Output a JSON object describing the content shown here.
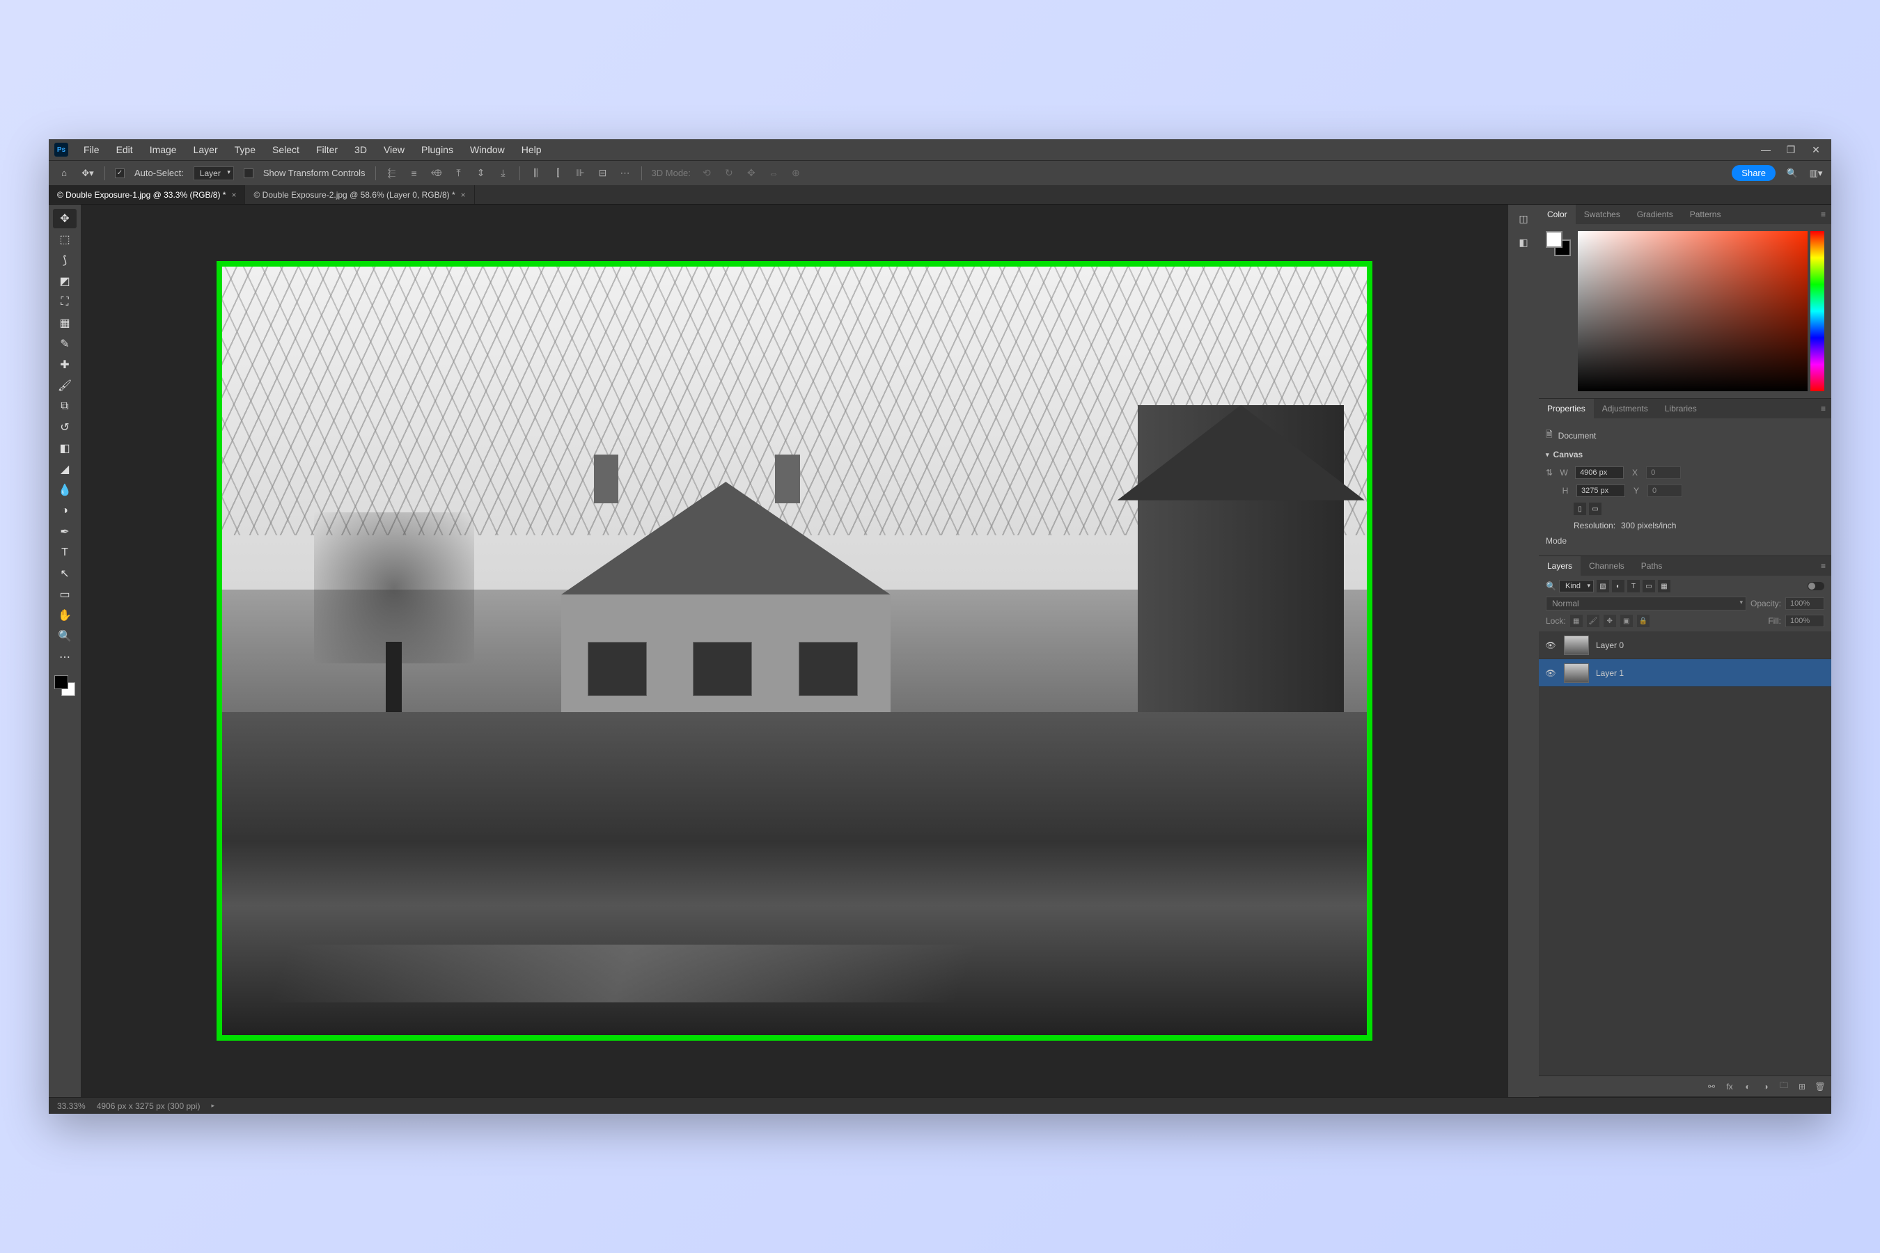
{
  "menubar": {
    "items": [
      "File",
      "Edit",
      "Image",
      "Layer",
      "Type",
      "Select",
      "Filter",
      "3D",
      "View",
      "Plugins",
      "Window",
      "Help"
    ]
  },
  "window_controls": {
    "minimize": "—",
    "maximize": "❐",
    "close": "✕"
  },
  "options": {
    "auto_select_label": "Auto-Select:",
    "layer_dropdown": "Layer",
    "show_transform": "Show Transform Controls",
    "mode_3d": "3D Mode:"
  },
  "share_button": "Share",
  "tabs": [
    {
      "title": "© Double Exposure-1.jpg @ 33.3% (RGB/8) *",
      "active": true
    },
    {
      "title": "© Double Exposure-2.jpg @ 58.6% (Layer 0, RGB/8) *",
      "active": false
    }
  ],
  "tools": [
    {
      "name": "move",
      "glyph": "✥",
      "active": true
    },
    {
      "name": "marquee",
      "glyph": "⬚"
    },
    {
      "name": "lasso",
      "glyph": "⟆"
    },
    {
      "name": "object-select",
      "glyph": "◩"
    },
    {
      "name": "crop",
      "glyph": "⛶"
    },
    {
      "name": "frame",
      "glyph": "▦"
    },
    {
      "name": "eyedropper",
      "glyph": "✎"
    },
    {
      "name": "healing",
      "glyph": "✚"
    },
    {
      "name": "brush",
      "glyph": "🖌"
    },
    {
      "name": "clone",
      "glyph": "⧉"
    },
    {
      "name": "history-brush",
      "glyph": "↺"
    },
    {
      "name": "eraser",
      "glyph": "◧"
    },
    {
      "name": "gradient",
      "glyph": "◢"
    },
    {
      "name": "blur",
      "glyph": "💧"
    },
    {
      "name": "dodge",
      "glyph": "◑"
    },
    {
      "name": "pen",
      "glyph": "✒"
    },
    {
      "name": "type",
      "glyph": "T"
    },
    {
      "name": "path",
      "glyph": "↖"
    },
    {
      "name": "shape",
      "glyph": "▭"
    },
    {
      "name": "hand",
      "glyph": "✋"
    },
    {
      "name": "zoom",
      "glyph": "🔍"
    },
    {
      "name": "edit-toolbar",
      "glyph": "⋯"
    }
  ],
  "status": {
    "zoom": "33.33%",
    "info": "4906 px x 3275 px (300 ppi)"
  },
  "color_tabs": [
    "Color",
    "Swatches",
    "Gradients",
    "Patterns"
  ],
  "properties": {
    "tabs": [
      "Properties",
      "Adjustments",
      "Libraries"
    ],
    "doc_label": "Document",
    "canvas_section": "Canvas",
    "w_label": "W",
    "w_value": "4906 px",
    "h_label": "H",
    "h_value": "3275 px",
    "x_label": "X",
    "x_value": "0",
    "y_label": "Y",
    "y_value": "0",
    "orient_portrait": "▯",
    "orient_landscape": "▭",
    "resolution_label": "Resolution:",
    "resolution_value": "300 pixels/inch",
    "mode_label": "Mode"
  },
  "layers": {
    "tabs": [
      "Layers",
      "Channels",
      "Paths"
    ],
    "kind_label": "Kind",
    "blend_mode": "Normal",
    "opacity_label": "Opacity:",
    "opacity_value": "100%",
    "lock_label": "Lock:",
    "fill_label": "Fill:",
    "fill_value": "100%",
    "items": [
      {
        "name": "Layer 0",
        "selected": false
      },
      {
        "name": "Layer 1",
        "selected": true
      }
    ]
  }
}
